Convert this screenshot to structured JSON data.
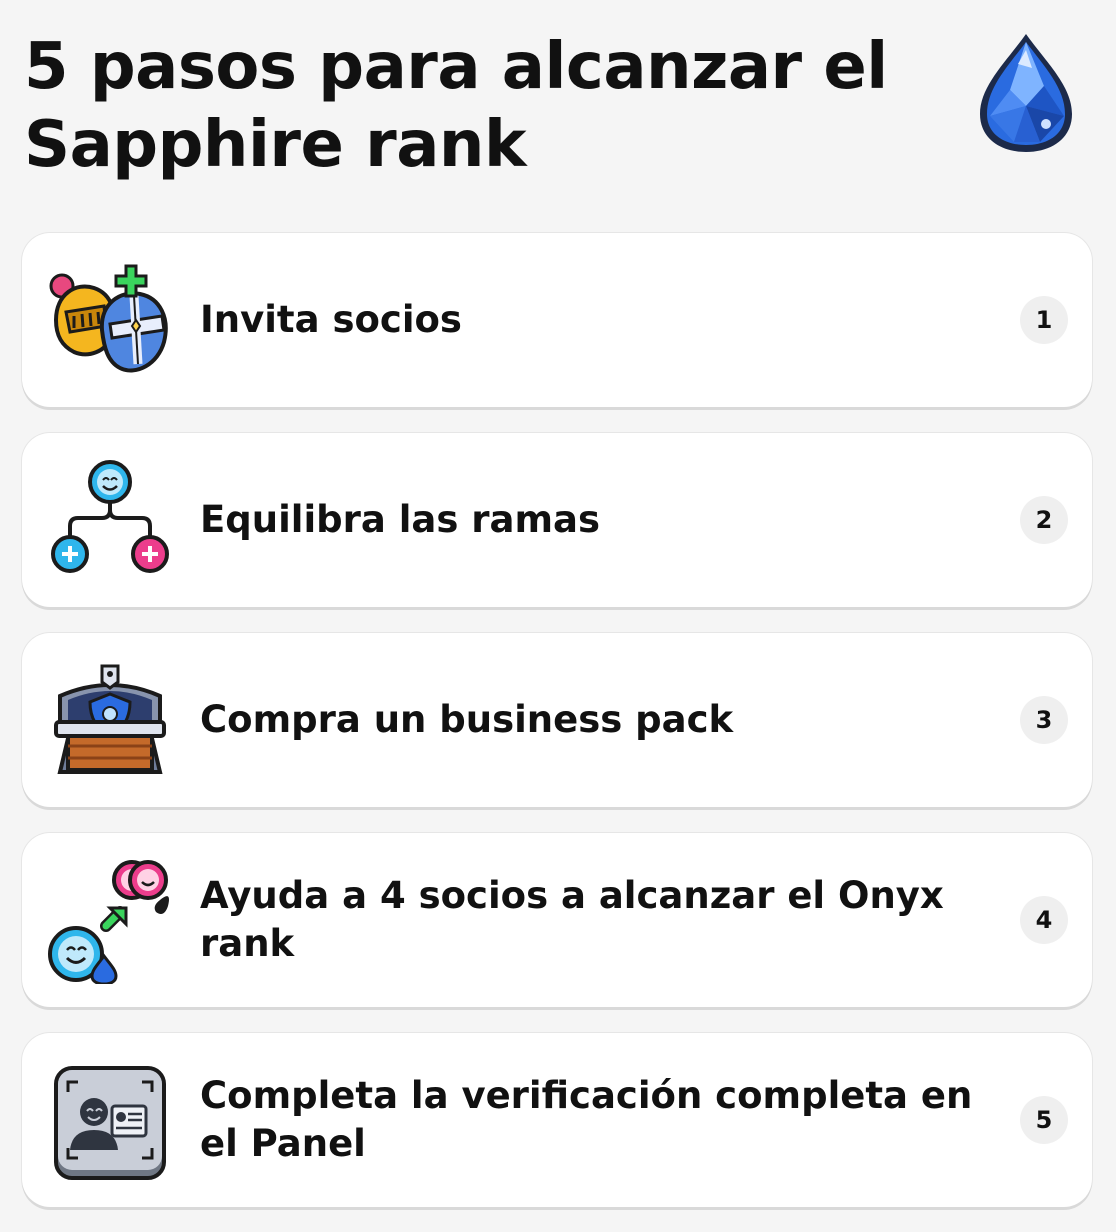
{
  "header": {
    "title": "5 pasos para alcanzar el Sapphire rank",
    "icon": "sapphire-gem-icon"
  },
  "steps": [
    {
      "label": "Invita socios",
      "number": "1",
      "icon": "knight-helmets-plus-icon"
    },
    {
      "label": "Equilibra las ramas",
      "number": "2",
      "icon": "branch-tree-icon"
    },
    {
      "label": "Compra un business pack",
      "number": "3",
      "icon": "treasure-chest-icon"
    },
    {
      "label": "Ayuda a 4 socios a alcanzar el Onyx rank",
      "number": "4",
      "icon": "upgrade-partners-icon"
    },
    {
      "label": "Completa la verificación completa en el Panel",
      "number": "5",
      "icon": "id-verification-icon"
    }
  ],
  "colors": {
    "background": "#f5f5f5",
    "card": "#ffffff",
    "number_badge": "#efefef",
    "sapphire_blue": "#2a6be0",
    "branch_cyan": "#2fb6ec",
    "branch_pink": "#ec3d8c"
  }
}
